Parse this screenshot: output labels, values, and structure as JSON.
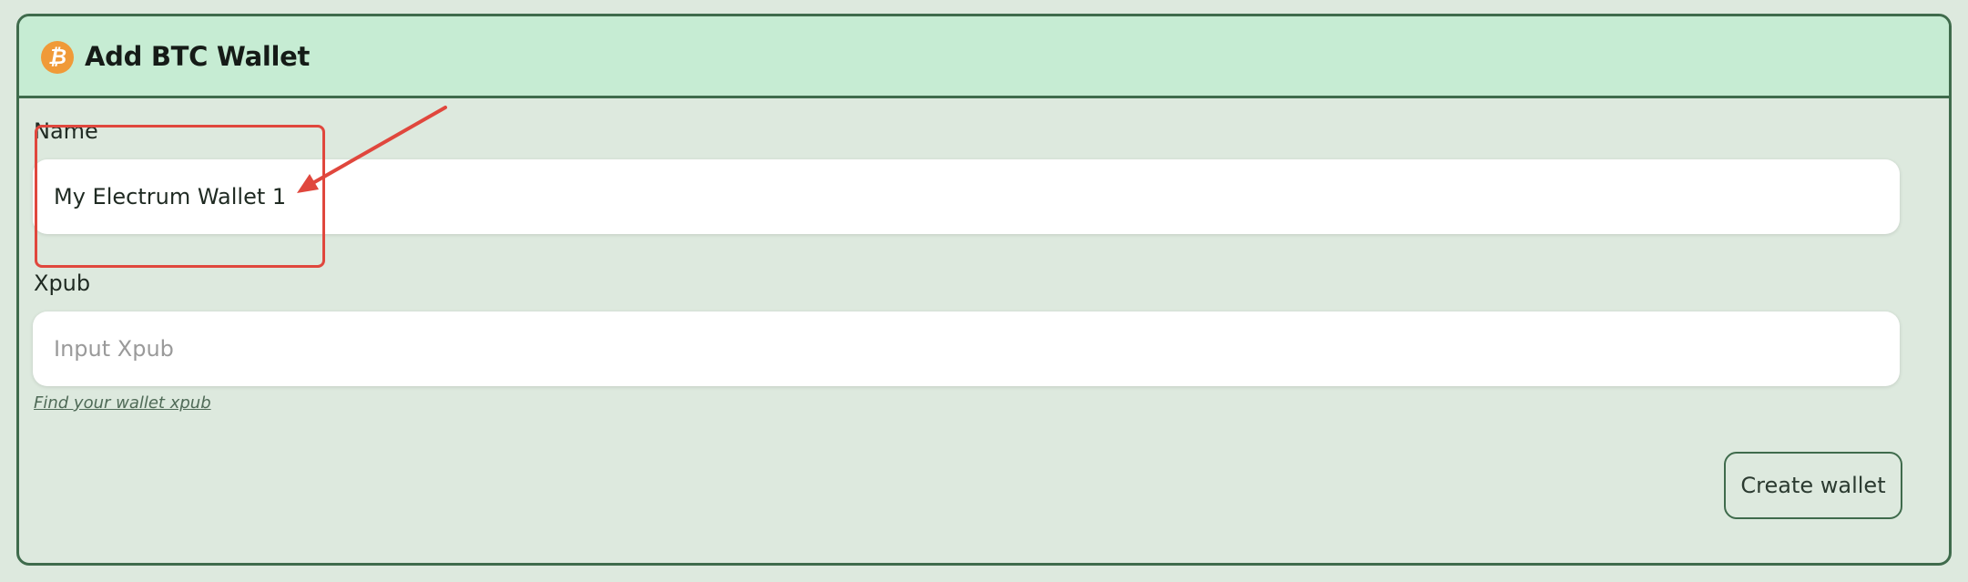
{
  "header": {
    "title": "Add BTC Wallet",
    "icon": "bitcoin-icon",
    "icon_glyph": "₿",
    "background_color": "#c6ecd3"
  },
  "form": {
    "name_field": {
      "label": "Name",
      "value": "My Electrum Wallet 1"
    },
    "xpub_field": {
      "label": "Xpub",
      "placeholder": "Input Xpub",
      "value": ""
    },
    "help_link": "Find your wallet xpub",
    "submit_label": "Create wallet"
  },
  "annotation": {
    "color": "#e0473d",
    "target": "name-field"
  },
  "colors": {
    "border": "#3f6b4c",
    "card_background": "#dde9de",
    "bitcoin_orange": "#f09a38"
  }
}
